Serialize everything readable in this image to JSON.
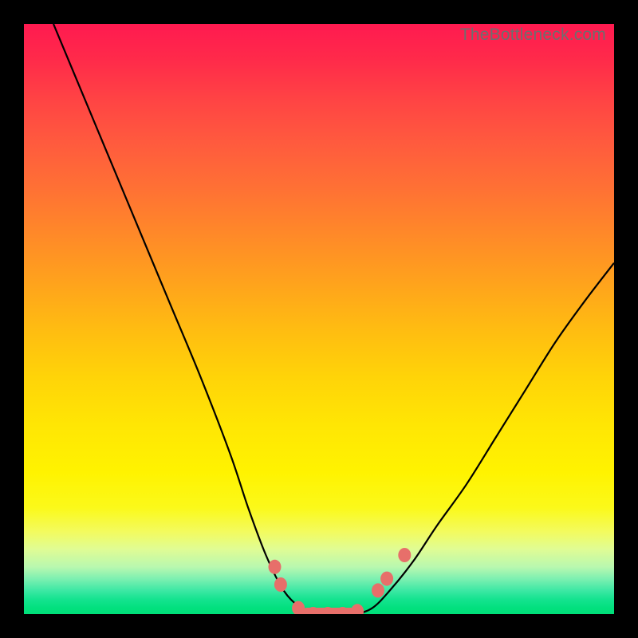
{
  "watermark": "TheBottleneck.com",
  "colors": {
    "frame": "#000000",
    "curve": "#000000",
    "marker": "#e76f6a"
  },
  "chart_data": {
    "type": "line",
    "title": "",
    "xlabel": "",
    "ylabel": "",
    "grid": false,
    "legend": false,
    "xlim": [
      0,
      100
    ],
    "ylim": [
      0,
      100
    ],
    "background_gradient": {
      "top_color": "#ff1a50",
      "mid_color": "#fff300",
      "bottom_color": "#00df79"
    },
    "series": [
      {
        "name": "bottleneck-curve",
        "note": "V-shaped curve; y reaches 0 at the flat valley and 100 at the top edge. Values estimated from pixels.",
        "x": [
          5,
          10,
          15,
          20,
          25,
          30,
          35,
          38,
          41,
          44,
          47,
          50,
          53,
          56,
          59,
          62,
          66,
          70,
          75,
          80,
          85,
          90,
          95,
          100
        ],
        "y": [
          100,
          88,
          76,
          64,
          52,
          40,
          27,
          18,
          10,
          4,
          1,
          0,
          0,
          0,
          1,
          4,
          9,
          15,
          22,
          30,
          38,
          46,
          53,
          59.5
        ]
      }
    ],
    "markers": {
      "name": "salmon-dots",
      "note": "Clustered markers near the valley of the curve. Coordinates estimated from pixels on same 0–100 scale.",
      "points": [
        {
          "x": 42.5,
          "y": 8
        },
        {
          "x": 43.5,
          "y": 5
        },
        {
          "x": 46.5,
          "y": 1
        },
        {
          "x": 49.0,
          "y": 0
        },
        {
          "x": 51.5,
          "y": 0
        },
        {
          "x": 54.0,
          "y": 0
        },
        {
          "x": 56.5,
          "y": 0.5
        },
        {
          "x": 60.0,
          "y": 4
        },
        {
          "x": 61.5,
          "y": 6
        },
        {
          "x": 64.5,
          "y": 10
        }
      ]
    }
  }
}
